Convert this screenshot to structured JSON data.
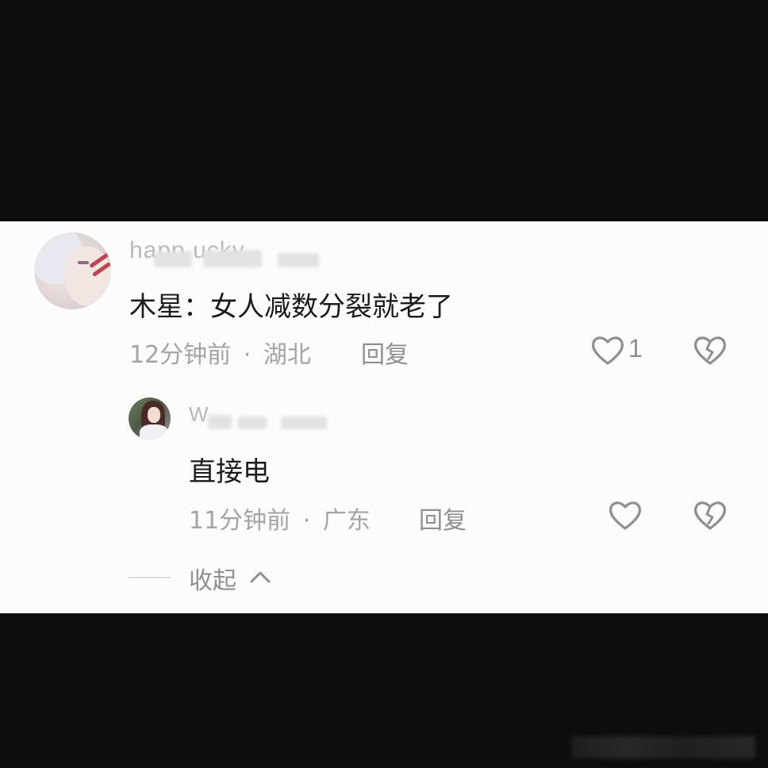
{
  "comment": {
    "username": "happ  ucky",
    "text": "木星：女人减数分裂就老了",
    "time": "12分钟前",
    "separator": "·",
    "location": "湖北",
    "reply_label": "回复",
    "like_count": "1",
    "like_icon": "heart-outline-icon",
    "dislike_icon": "broken-heart-icon",
    "avatar_icon": "anime-avatar-white-hair"
  },
  "reply": {
    "username": "W",
    "text": "直接电",
    "time": "11分钟前",
    "separator": "·",
    "location": "广东",
    "reply_label": "回复",
    "like_icon": "heart-outline-icon",
    "dislike_icon": "broken-heart-icon",
    "avatar_icon": "anime-avatar-brown-hair"
  },
  "collapse": {
    "label": "收起",
    "icon": "chevron-up-icon"
  },
  "colors": {
    "panel_bg": "#fcfcfc",
    "backdrop": "#0d0d0d",
    "text_primary": "#1b1b1b",
    "text_secondary": "#a4a4a4",
    "icon_gray": "#8f8f8f"
  }
}
